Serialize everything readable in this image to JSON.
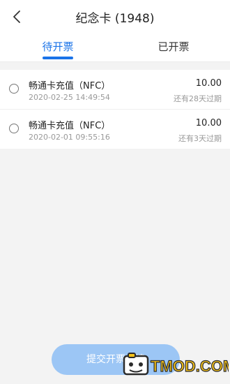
{
  "header": {
    "title": "纪念卡 (1948)"
  },
  "tabs": [
    {
      "label": "待开票",
      "active": true
    },
    {
      "label": "已开票",
      "active": false
    }
  ],
  "items": [
    {
      "name": "畅通卡充值（NFC）",
      "time": "2020-02-25 14:49:54",
      "amount": "10.00",
      "expire": "还有28天过期"
    },
    {
      "name": "畅通卡充值（NFC）",
      "time": "2020-02-01 09:55:16",
      "amount": "10.00",
      "expire": "还有3天过期"
    }
  ],
  "submit": {
    "label": "提交开票申请"
  },
  "watermark": {
    "text": "TMOD.COM"
  },
  "colors": {
    "accent": "#1a73e8",
    "button_disabled": "#9cc6f5",
    "background": "#f3f3f3"
  }
}
